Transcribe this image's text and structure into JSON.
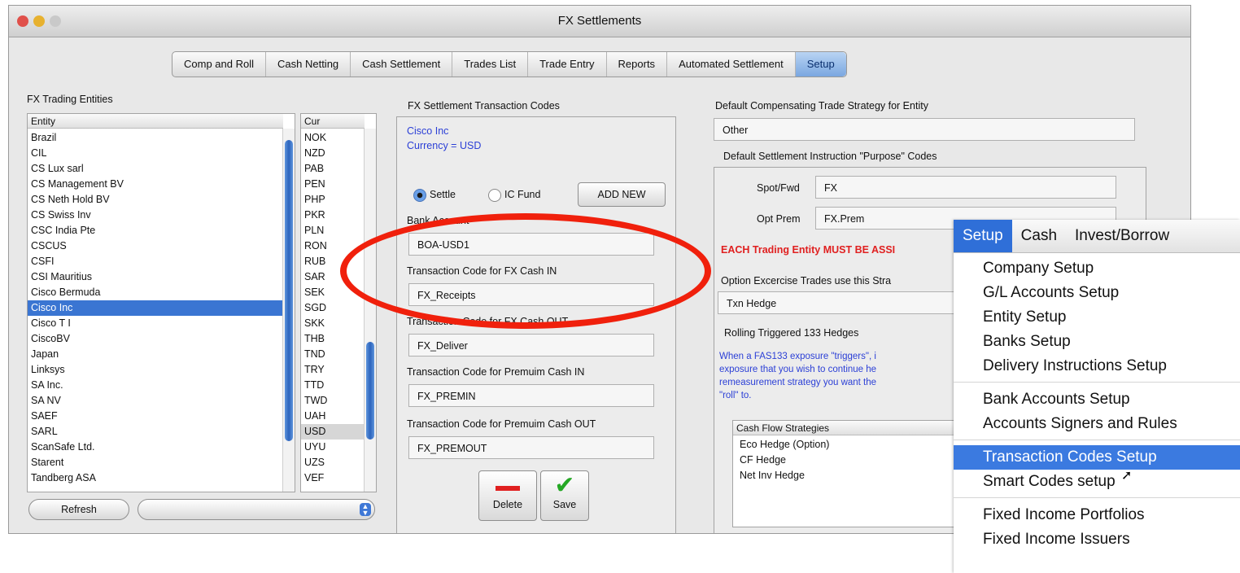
{
  "window": {
    "title": "FX Settlements"
  },
  "tabs": [
    {
      "label": "Comp and Roll"
    },
    {
      "label": "Cash Netting"
    },
    {
      "label": "Cash Settlement"
    },
    {
      "label": "Trades List"
    },
    {
      "label": "Trade Entry"
    },
    {
      "label": "Reports"
    },
    {
      "label": "Automated Settlement"
    },
    {
      "label": "Setup"
    }
  ],
  "entities_panel": {
    "title": "FX Trading Entities",
    "col_entity": "Entity",
    "col_cur": "Cur",
    "entities": [
      "Brazil",
      "CIL",
      "CS Lux sarl",
      "CS Management BV",
      "CS Neth Hold BV",
      "CS Swiss Inv",
      "CSC India Pte",
      "CSCUS",
      "CSFI",
      "CSI Mauritius",
      "Cisco Bermuda",
      "Cisco Inc",
      "Cisco T I",
      "CiscoBV",
      "Japan",
      "Linksys",
      "SA Inc.",
      "SA NV",
      "SAEF",
      "SARL",
      "ScanSafe Ltd.",
      "Starent",
      "Tandberg ASA"
    ],
    "selected_entity": "Cisco Inc",
    "currencies": [
      "NOK",
      "NZD",
      "PAB",
      "PEN",
      "PHP",
      "PKR",
      "PLN",
      "RON",
      "RUB",
      "SAR",
      "SEK",
      "SGD",
      "SKK",
      "THB",
      "TND",
      "TRY",
      "TTD",
      "TWD",
      "UAH",
      "USD",
      "UYU",
      "UZS",
      "VEF"
    ],
    "selected_currency": "USD",
    "refresh_label": "Refresh"
  },
  "txn_codes": {
    "title": "FX Settlement Transaction Codes",
    "entity_name": "Cisco Inc",
    "currency_line": "Currency = USD",
    "radio_settle": "Settle",
    "radio_ic_fund": "IC Fund",
    "add_new": "ADD NEW",
    "bank_account_label": "Bank Account",
    "bank_account_value": "BOA-USD1",
    "cash_in_label": "Transaction Code for FX Cash IN",
    "cash_in_value": "FX_Receipts",
    "cash_out_label": "Transaction Code for FX Cash OUT",
    "cash_out_value": "FX_Deliver",
    "prem_in_label": "Transaction Code for Premuim Cash IN",
    "prem_in_value": "FX_PREMIN",
    "prem_out_label": "Transaction Code for Premuim Cash OUT",
    "prem_out_value": "FX_PREMOUT",
    "delete_label": "Delete",
    "save_label": "Save"
  },
  "right_panel": {
    "comp_strategy_label": "Default Compensating Trade Strategy for Entity",
    "comp_strategy_value": "Other",
    "purpose_codes_label": "Default Settlement Instruction \"Purpose\" Codes",
    "spot_label": "Spot/Fwd",
    "spot_value": "FX",
    "opt_label": "Opt Prem",
    "opt_value": "FX.Prem",
    "warning": "EACH Trading Entity MUST BE ASSI",
    "option_label": "Option Excercise Trades use this Stra",
    "option_value": "Txn Hedge",
    "rolling_label": "Rolling Triggered 133 Hedges",
    "rolling_text_1": "When a FAS133 exposure \"triggers\", i",
    "rolling_text_2": "exposure that you wish to continue he",
    "rolling_text_3": "remeasurement strategy you want the",
    "rolling_text_4": "\"roll\" to.",
    "strategies_head": "Cash Flow Strategies",
    "strategies": [
      "Eco Hedge (Option)",
      "CF Hedge",
      "Net Inv Hedge"
    ]
  },
  "menu": {
    "bar": [
      "Setup",
      "Cash",
      "Invest/Borrow"
    ],
    "group1": [
      "Company Setup",
      "G/L Accounts Setup",
      "Entity Setup",
      "Banks Setup",
      "Delivery Instructions Setup"
    ],
    "group2": [
      "Bank Accounts Setup",
      "Accounts Signers and Rules"
    ],
    "group3": [
      "Transaction Codes Setup",
      "Smart Codes setup"
    ],
    "group4": [
      "Fixed Income Portfolios",
      "Fixed Income Issuers"
    ]
  },
  "colors": {
    "accent": "#3a75d2",
    "highlight_oval": "#f0200c",
    "blue_text": "#2b3fd6",
    "warning_red": "#e02020"
  }
}
